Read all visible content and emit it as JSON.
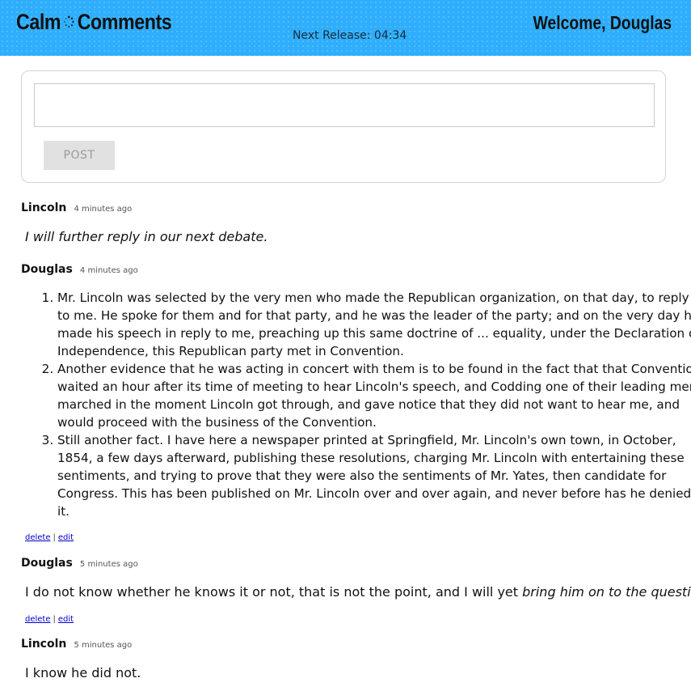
{
  "header": {
    "logo_left": "Calm",
    "logo_right": "Comments",
    "release": "Next Release: 04:34",
    "welcome": "Welcome, Douglas",
    "background_color": "#2eaefc"
  },
  "composer": {
    "placeholder": "",
    "post_label": "POST"
  },
  "comments": [
    {
      "author": "Lincoln",
      "time": "4 minutes ago",
      "text": "I will further reply in our next debate."
    },
    {
      "author": "Douglas",
      "time": "4 minutes ago",
      "items": [
        "Mr. Lincoln was selected by the very men who made the Republican organization, on that day, to reply to me. He spoke for them and for that party, and he was the leader of the party; and on the very day he made his speech in reply to me, preaching up this same doctrine of ... equality, under the Declaration of Independence, this Republican party met in Convention.",
        "Another evidence that he was acting in concert with them is to be found in the fact that that Convention waited an hour after its time of meeting to hear Lincoln's speech, and Codding one of their leading men, marched in the moment Lincoln got through, and gave notice that they did not want to hear me, and would proceed with the business of the Convention.",
        "Still another fact. I have here a newspaper printed at Springfield, Mr. Lincoln's own town, in October, 1854, a few days afterward, publishing these resolutions, charging Mr. Lincoln with entertaining these sentiments, and trying to prove that they were also the sentiments of Mr. Yates, then candidate for Congress. This has been published on Mr. Lincoln over and over again, and never before has he denied it."
      ],
      "delete_label": "delete",
      "separator": "|",
      "edit_label": "edit"
    },
    {
      "author": "Douglas",
      "time": "5 minutes ago",
      "text_plain": "I do not know whether he knows it or not, that is not the point, and I will yet ",
      "text_italic": "bring him on to the question.",
      "delete_label": "delete",
      "separator": "|",
      "edit_label": "edit"
    },
    {
      "author": "Lincoln",
      "time": "5 minutes ago",
      "text": "I know he did not."
    }
  ]
}
